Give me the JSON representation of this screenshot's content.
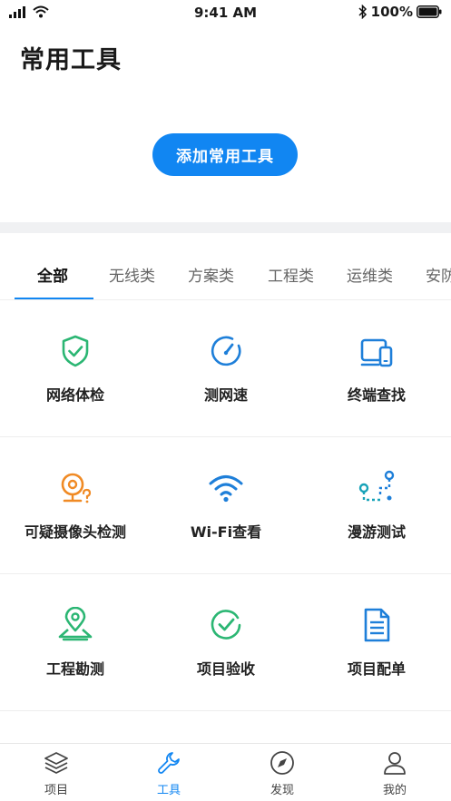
{
  "status": {
    "time": "9:41 AM",
    "battery": "100%"
  },
  "header": {
    "title": "常用工具"
  },
  "add_button": {
    "label": "添加常用工具"
  },
  "tabs": [
    {
      "label": "全部",
      "active": true
    },
    {
      "label": "无线类"
    },
    {
      "label": "方案类"
    },
    {
      "label": "工程类"
    },
    {
      "label": "运维类"
    },
    {
      "label": "安防类"
    }
  ],
  "tools": [
    {
      "label": "网络体检",
      "icon": "shield-check-icon",
      "color": "#2bb673"
    },
    {
      "label": "测网速",
      "icon": "speedometer-icon",
      "color": "#1e7fd9"
    },
    {
      "label": "终端查找",
      "icon": "devices-icon",
      "color": "#1e7fd9"
    },
    {
      "label": "可疑摄像头检测",
      "icon": "camera-question-icon",
      "color": "#f08a24"
    },
    {
      "label": "Wi-Fi查看",
      "icon": "wifi-icon",
      "color": "#1e7fd9"
    },
    {
      "label": "漫游测试",
      "icon": "roaming-path-icon",
      "color": "#17a2b8"
    },
    {
      "label": "工程勘测",
      "icon": "map-pin-icon",
      "color": "#2bb673"
    },
    {
      "label": "项目验收",
      "icon": "check-circle-icon",
      "color": "#2bb673"
    },
    {
      "label": "项目配单",
      "icon": "document-icon",
      "color": "#1e7fd9"
    }
  ],
  "tabbar": [
    {
      "label": "项目",
      "icon": "layers-icon"
    },
    {
      "label": "工具",
      "icon": "wrench-icon",
      "active": true
    },
    {
      "label": "发现",
      "icon": "compass-icon"
    },
    {
      "label": "我的",
      "icon": "user-icon"
    }
  ],
  "colors": {
    "accent": "#1186f2"
  }
}
